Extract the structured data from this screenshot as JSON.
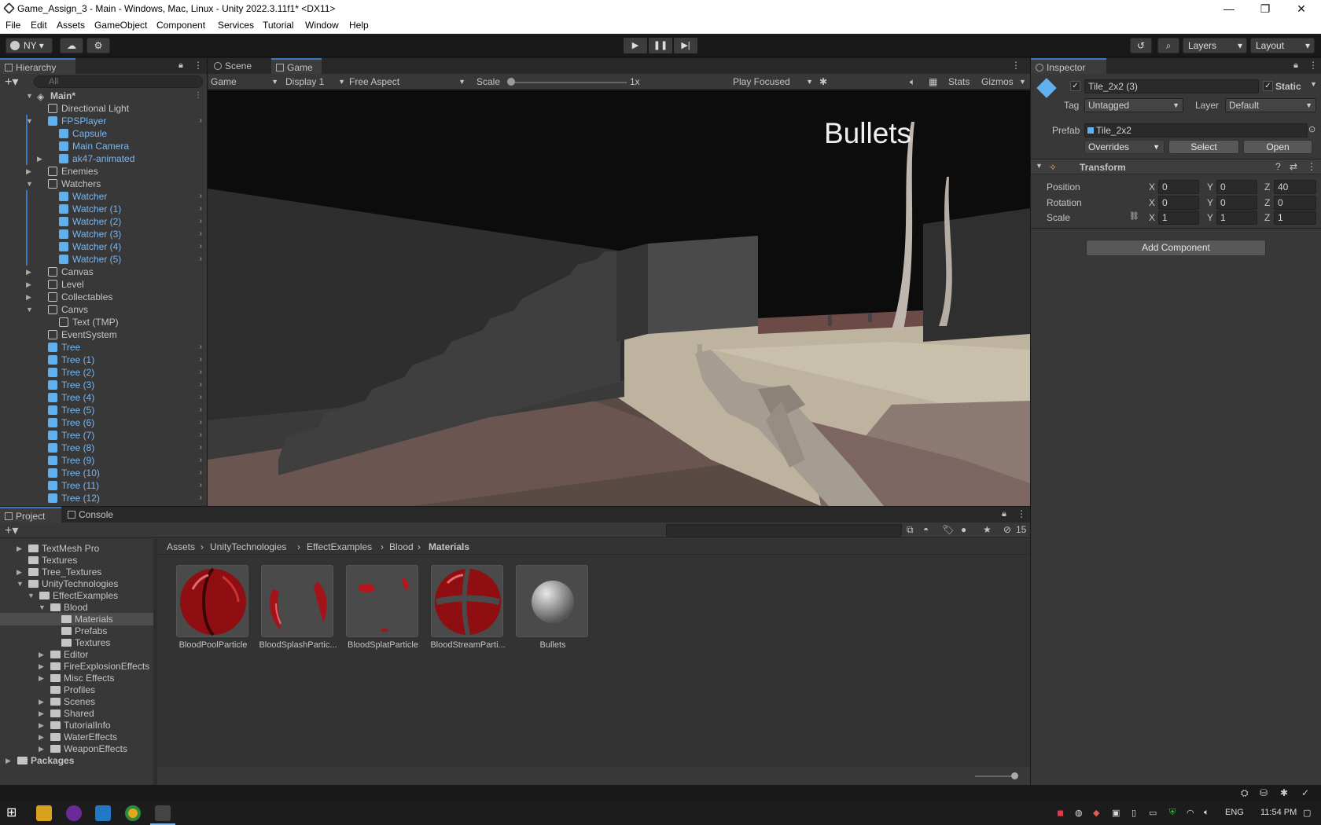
{
  "window": {
    "title": "Game_Assign_3 - Main - Windows, Mac, Linux - Unity 2022.3.11f1* <DX11>",
    "minimize": "—",
    "maximize": "❐",
    "close": "✕"
  },
  "menu": [
    "File",
    "Edit",
    "Assets",
    "GameObject",
    "Component",
    "Services",
    "Tutorial",
    "Window",
    "Help"
  ],
  "toolbar": {
    "account": "NY",
    "layers": "Layers",
    "layout": "Layout"
  },
  "hierarchy": {
    "tab": "Hierarchy",
    "search_placeholder": "All",
    "scene": "Main*",
    "rows": [
      {
        "label": "Directional Light"
      },
      {
        "label": "FPSPlayer"
      },
      {
        "label": "Capsule"
      },
      {
        "label": "Main Camera"
      },
      {
        "label": "ak47-animated"
      },
      {
        "label": "Enemies"
      },
      {
        "label": "Watchers"
      },
      {
        "label": "Watcher"
      },
      {
        "label": "Watcher (1)"
      },
      {
        "label": "Watcher (2)"
      },
      {
        "label": "Watcher (3)"
      },
      {
        "label": "Watcher (4)"
      },
      {
        "label": "Watcher (5)"
      },
      {
        "label": "Canvas"
      },
      {
        "label": "Level"
      },
      {
        "label": "Collectables"
      },
      {
        "label": "Canvs"
      },
      {
        "label": "Text (TMP)"
      },
      {
        "label": "EventSystem"
      },
      {
        "label": "Tree"
      },
      {
        "label": "Tree (1)"
      },
      {
        "label": "Tree (2)"
      },
      {
        "label": "Tree (3)"
      },
      {
        "label": "Tree (4)"
      },
      {
        "label": "Tree (5)"
      },
      {
        "label": "Tree (6)"
      },
      {
        "label": "Tree (7)"
      },
      {
        "label": "Tree (8)"
      },
      {
        "label": "Tree (9)"
      },
      {
        "label": "Tree (10)"
      },
      {
        "label": "Tree (11)"
      },
      {
        "label": "Tree (12)"
      }
    ]
  },
  "game": {
    "tabs": [
      "Scene",
      "Game"
    ],
    "mode": "Game",
    "display": "Display 1",
    "aspect": "Free Aspect",
    "scale_label": "Scale",
    "scale_value": "1x",
    "play_mode": "Play Focused",
    "stats": "Stats",
    "gizmos": "Gizmos",
    "hud_text": "Bullets"
  },
  "inspector": {
    "tab": "Inspector",
    "object_name": "Tile_2x2 (3)",
    "static_label": "Static",
    "tag_label": "Tag",
    "tag_value": "Untagged",
    "layer_label": "Layer",
    "layer_value": "Default",
    "prefab_label": "Prefab",
    "prefab_value": "Tile_2x2",
    "overrides": "Overrides",
    "select": "Select",
    "open": "Open",
    "transform": "Transform",
    "position_label": "Position",
    "rotation_label": "Rotation",
    "scale_label": "Scale",
    "position": {
      "x": "0",
      "y": "0",
      "z": "40"
    },
    "rotation": {
      "x": "0",
      "y": "0",
      "z": "0"
    },
    "scale": {
      "x": "1",
      "y": "1",
      "z": "1"
    },
    "axis": {
      "x": "X",
      "y": "Y",
      "z": "Z"
    },
    "add_component": "Add Component"
  },
  "project": {
    "tabs": [
      "Project",
      "Console"
    ],
    "hidden_count": "15",
    "breadcrumb": [
      "Assets",
      "UnityTechnologies",
      "EffectExamples",
      "Blood",
      "Materials"
    ],
    "tree": [
      {
        "label": "TextMesh Pro"
      },
      {
        "label": "Textures"
      },
      {
        "label": "Tree_Textures"
      },
      {
        "label": "UnityTechnologies"
      },
      {
        "label": "EffectExamples"
      },
      {
        "label": "Blood"
      },
      {
        "label": "Materials"
      },
      {
        "label": "Prefabs"
      },
      {
        "label": "Textures"
      },
      {
        "label": "Editor"
      },
      {
        "label": "FireExplosionEffects"
      },
      {
        "label": "Misc Effects"
      },
      {
        "label": "Profiles"
      },
      {
        "label": "Scenes"
      },
      {
        "label": "Shared"
      },
      {
        "label": "TutorialInfo"
      },
      {
        "label": "WaterEffects"
      },
      {
        "label": "WeaponEffects"
      },
      {
        "label": "Packages"
      }
    ],
    "assets": [
      {
        "name": "BloodPoolParticle"
      },
      {
        "name": "BloodSplashPartic..."
      },
      {
        "name": "BloodSplatParticle"
      },
      {
        "name": "BloodStreamParti..."
      },
      {
        "name": "Bullets"
      }
    ]
  },
  "taskbar": {
    "lang": "ENG",
    "time": "11:54 PM"
  }
}
